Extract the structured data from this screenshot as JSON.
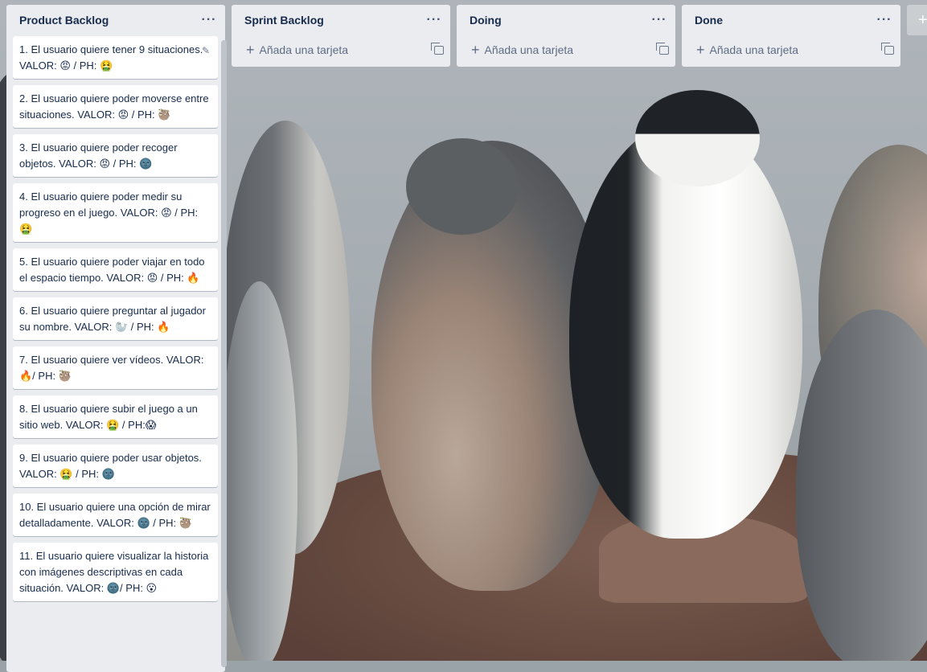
{
  "lists": [
    {
      "title": "Product Backlog",
      "menu": "···",
      "cards": [
        "1. El usuario quiere tener 9 situaciones. VALOR: 😡 / PH: 🤮",
        "2. El usuario quiere poder moverse entre situaciones. VALOR: 😡 / PH: 🦥",
        "3. El usuario quiere poder recoger objetos. VALOR: 😡 / PH: 🌚",
        "4. El usuario quiere poder medir su progreso en el juego. VALOR: 😡 / PH: 🤮",
        "5. El usuario quiere poder viajar en todo el espacio tiempo. VALOR: 😡 / PH: 🔥",
        "6. El usuario quiere preguntar al jugador su nombre. VALOR: 🦭 / PH: 🔥",
        "7. El usuario quiere ver vídeos. VALOR: 🔥/ PH: 🦥",
        "8. El usuario quiere subir el juego a un sitio web. VALOR: 🤮 / PH:😱",
        "9. El usuario quiere poder usar objetos. VALOR: 🤮 / PH: 🌚",
        "10. El usuario quiere una opción de mirar detalladamente. VALOR: 🌚 / PH: 🦥",
        "11. El usuario quiere visualizar la historia con imágenes descriptivas en cada situación. VALOR: 🌚/ PH: 😮"
      ]
    },
    {
      "title": "Sprint Backlog",
      "menu": "···",
      "add_label": "Añada una tarjeta"
    },
    {
      "title": "Doing",
      "menu": "···",
      "add_label": "Añada una tarjeta"
    },
    {
      "title": "Done",
      "menu": "···",
      "add_label": "Añada una tarjeta"
    }
  ],
  "add_list_symbol": "+",
  "icons": {
    "edit": "pencil-icon",
    "add": "plus-icon",
    "template": "card-template-icon"
  }
}
